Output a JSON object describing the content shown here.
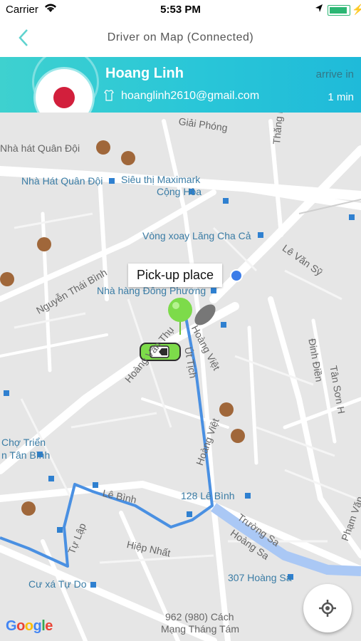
{
  "status_bar": {
    "carrier": "Carrier",
    "time": "5:53 PM"
  },
  "nav": {
    "title": "Driver on Map (Connected)"
  },
  "driver": {
    "name": "Hoang Linh",
    "email": "hoanglinh2610@gmail.com",
    "arrive_label": "arrive in",
    "eta": "1 min"
  },
  "map": {
    "pickup_label": "Pick-up place",
    "labels": {
      "giai_phong": "Giải Phóng",
      "nha_hat_quan_doi_1": "Nhà hát Quân Đội",
      "nha_hat_quan_doi_2": "Nhà Hát Quân Đội",
      "sieu_thi": "Siêu thị Maximark",
      "cong_hoa": "Cộng Hòa",
      "vong_xoay": "Vòng xoay Lăng Cha Cả",
      "le_van_sy": "Lê Văn Sỹ",
      "nguyen_thai_binh": "Nguyễn Thái Bình",
      "nha_hang": "Nhà hàng Đông Phương",
      "hoang_van_thu": "Hoàng Văn Thụ",
      "hoang_viet_1": "Hoàng Việt",
      "hoang_viet_2": "Hoàng Việt",
      "ut_tich": "Út Tịch",
      "thang_long": "Thăng Long",
      "dinh_dien": "Đinh Điền",
      "tan_son_h": "Tân Sơn H",
      "cho_tan_binh_1": "Chợ Triển",
      "cho_tan_binh_2": "n Tân Bình",
      "le_binh": "Lê Bình",
      "le_binh_128": "128 Lê Bình",
      "truong_sa": "Trường Sa",
      "hoang_sa": "Hoàng Sa",
      "hoang_sa_307": "307 Hoàng Sa",
      "hiep_nhat": "Hiệp Nhất",
      "tu_lap": "Tự Lập",
      "cu_xa": "Cư xá Tự Do",
      "pham_van": "Phạm Văn",
      "cach_mang_1": "962 (980) Cách",
      "cach_mang_2": "Mạng Tháng Tám"
    }
  },
  "google_logo": [
    "G",
    "o",
    "o",
    "g",
    "l",
    "e"
  ],
  "colors": {
    "route": "#4a90e2",
    "header_start": "#3ed1cf",
    "header_end": "#1fbad9",
    "pin": "#7ddb4a"
  }
}
